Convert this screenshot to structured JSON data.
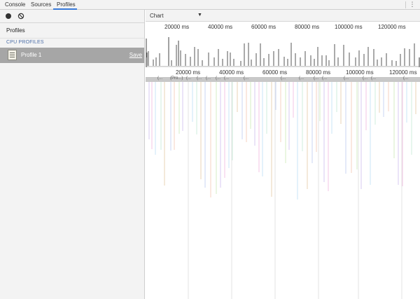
{
  "tabs": [
    {
      "label": "Console",
      "active": false
    },
    {
      "label": "Sources",
      "active": false
    },
    {
      "label": "Profiles",
      "active": true
    }
  ],
  "menu_icon": "kebab-menu-icon",
  "sidebar": {
    "record_icon": "record-icon",
    "clear_icon": "clear-icon",
    "title": "Profiles",
    "section": "CPU PROFILES",
    "items": [
      {
        "label": "Profile 1",
        "action": "Save",
        "icon": "cpu-profile-icon",
        "selected": true
      }
    ]
  },
  "main": {
    "view_select": {
      "value": "Chart",
      "arrow_icon": "dropdown-arrow-icon"
    },
    "overview_ticks": [
      "20000 ms",
      "40000 ms",
      "60000 ms",
      "80000 ms",
      "100000 ms",
      "120000 ms"
    ],
    "ruler_ticks": [
      "20000 ms",
      "40000 ms",
      "60000 ms",
      "80000 ms",
      "100000 ms",
      "120000 ms"
    ],
    "flame_labels": [
      "(...",
      "(Pro...)",
      "(...",
      "(...",
      "(...",
      "(...",
      "(...",
      "(...",
      "(...",
      "(...",
      "(...",
      "(...",
      "(...",
      "(...",
      "(...",
      "(..."
    ]
  },
  "colors": {
    "tab_active_underline": "#3879d9",
    "sidebar_bg": "#f3f3f3",
    "selected_item_bg": "#a6a6a6",
    "section_text": "#4d6fa8"
  }
}
